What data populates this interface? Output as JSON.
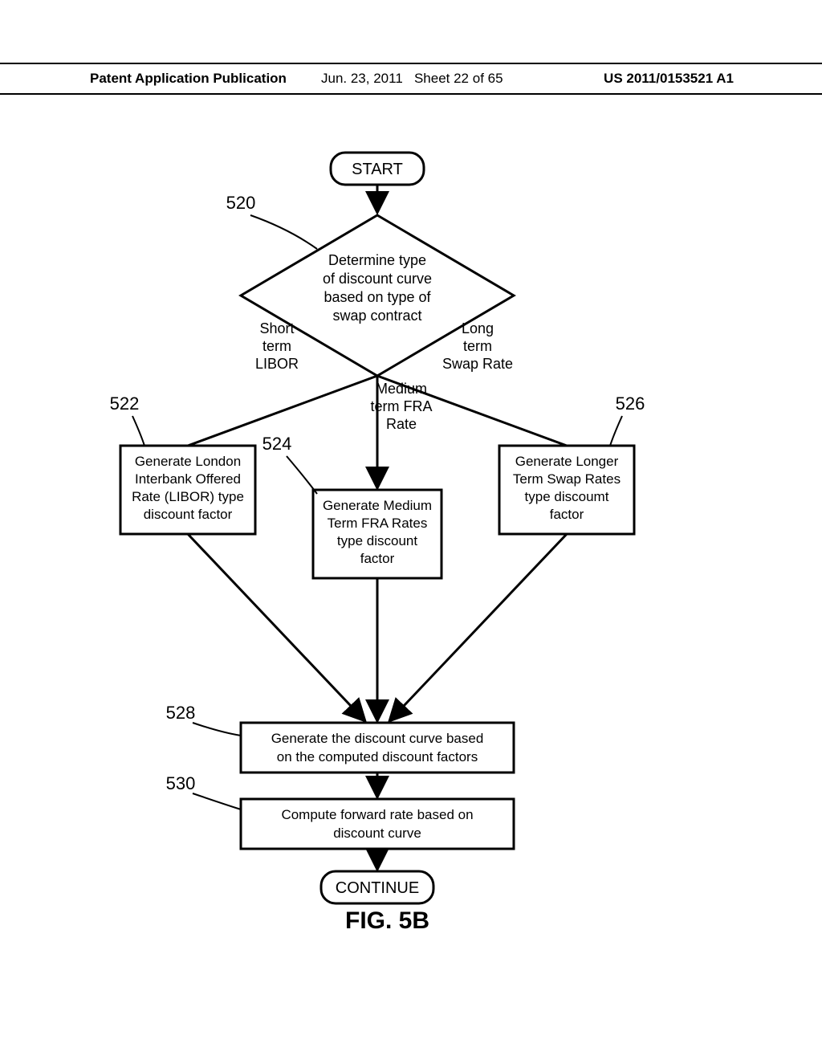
{
  "header": {
    "left": "Patent Application Publication",
    "date": "Jun. 23, 2011",
    "sheet": "Sheet 22 of 65",
    "pubno": "US 2011/0153521 A1"
  },
  "start": "START",
  "decision": {
    "l1": "Determine type",
    "l2": "of discount curve",
    "l3": "based on type of",
    "l4": "swap contract"
  },
  "branch_left": {
    "l1": "Short",
    "l2": "term",
    "l3": "LIBOR"
  },
  "branch_mid": {
    "l1": "Medium",
    "l2": "term FRA",
    "l3": "Rate"
  },
  "branch_right": {
    "l1": "Long",
    "l2": "term",
    "l3": "Swap Rate"
  },
  "box522": {
    "l1": "Generate London",
    "l2": "Interbank Offered",
    "l3": "Rate (LIBOR) type",
    "l4": "discount factor"
  },
  "box524": {
    "l1": "Generate Medium",
    "l2": "Term FRA Rates",
    "l3": "type discount",
    "l4": "factor"
  },
  "box526": {
    "l1": "Generate Longer",
    "l2": "Term Swap Rates",
    "l3": "type discoumt",
    "l4": "factor"
  },
  "box528": {
    "l1": "Generate the discount curve based",
    "l2": "on the computed discount factors"
  },
  "box530": {
    "l1": "Compute forward rate based on",
    "l2": "discount curve"
  },
  "continue": "CONTINUE",
  "labels": {
    "n520": "520",
    "n522": "522",
    "n524": "524",
    "n526": "526",
    "n528": "528",
    "n530": "530"
  },
  "figure": "FIG. 5B"
}
